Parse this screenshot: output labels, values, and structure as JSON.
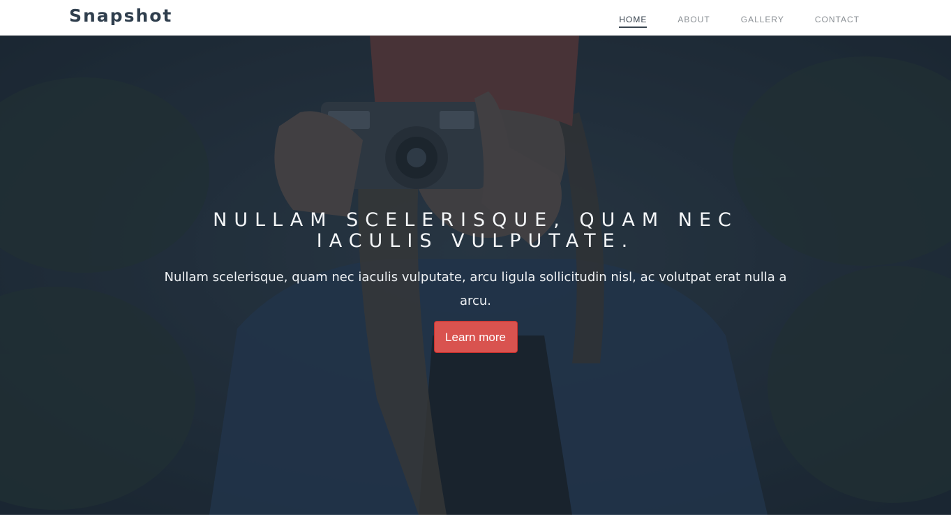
{
  "navbar": {
    "brand": "Snapshot",
    "items": [
      {
        "label": "HOME",
        "active": true
      },
      {
        "label": "ABOUT",
        "active": false
      },
      {
        "label": "GALLERY",
        "active": false
      },
      {
        "label": "CONTACT",
        "active": false
      }
    ]
  },
  "hero": {
    "title": "NULLAM SCELERISQUE, QUAM NEC IACULIS VULPUTATE.",
    "text": "Nullam scelerisque, quam nec iaculis vulputate, arcu ligula sollicitudin nisl, ac volutpat erat nulla a arcu.",
    "button_label": "Learn more",
    "overlay_color": "#1e2c3a",
    "button_color": "#d9534f"
  }
}
